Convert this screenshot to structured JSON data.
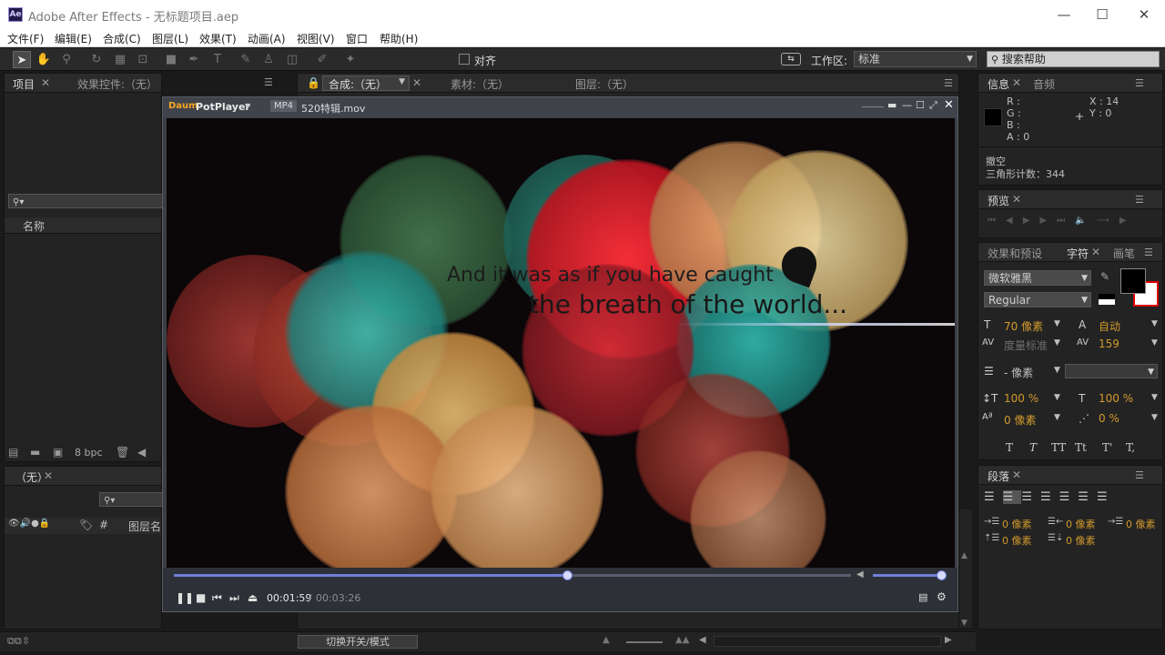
{
  "window": {
    "title": "Adobe After Effects - 无标题项目.aep",
    "logo_text": "Ae",
    "minimize": "—",
    "maximize": "☐",
    "close": "✕"
  },
  "menu": [
    "文件(F)",
    "编辑(E)",
    "合成(C)",
    "图层(L)",
    "效果(T)",
    "动画(A)",
    "视图(V)",
    "窗口",
    "帮助(H)"
  ],
  "toolbar": {
    "align_label": "对齐",
    "workspace_label": "工作区:",
    "workspace_value": "标准",
    "search_placeholder": "搜索帮助"
  },
  "project_panel": {
    "tab_project": "项目",
    "tab_effects": "效果控件:（无）",
    "column_name": "名称",
    "bpc": "8 bpc"
  },
  "viewer": {
    "tab_comp": "合成:（无）",
    "tab_footage": "素材:（无）",
    "tab_layer": "图层:（无）"
  },
  "timeline": {
    "tab": "（无）",
    "col_num": "#",
    "col_layer_name": "图层名",
    "toggle_label": "切换开关/模式"
  },
  "info_panel": {
    "tab_info": "信息",
    "tab_audio": "音频",
    "r": "R :",
    "g": "G :",
    "b": "B :",
    "a": "A : 0",
    "x": "X : 14",
    "y": "Y : 0",
    "line1": "撤空",
    "line2": "三角形计数：344"
  },
  "preview_panel": {
    "tab": "预览"
  },
  "char_panel": {
    "tab_effects": "效果和预设",
    "tab_char": "字符",
    "tab_paint": "画笔",
    "font": "微软雅黑",
    "style": "Regular",
    "size": "70 像素",
    "leading": "自动",
    "kerning": "度量标准",
    "tracking": "159",
    "stroke": "- 像素",
    "vscale": "100 %",
    "hscale": "100 %",
    "baseline": "0 像素",
    "tsume": "0 %",
    "styles": [
      "T",
      "T",
      "TT",
      "Tt",
      "T'",
      "T,"
    ]
  },
  "para_panel": {
    "tab": "段落",
    "v1": "0 像素",
    "v2": "0 像素",
    "v3": "0 像素",
    "v4": "0 像素",
    "v5": "0 像素"
  },
  "player": {
    "brand": "PotPlayer",
    "format": "MP4",
    "filename": "520特辑.mov",
    "subtitle_line1": "And it was as if you have caught",
    "subtitle_line2": "the breath of the world...",
    "current_time": "00:01:59",
    "separator": " / ",
    "total_time": "00:03:26",
    "progress": 0.58,
    "volume": 1.0,
    "colors": {
      "accent": "#6f7fd8",
      "bg": "#3c3e46"
    }
  }
}
